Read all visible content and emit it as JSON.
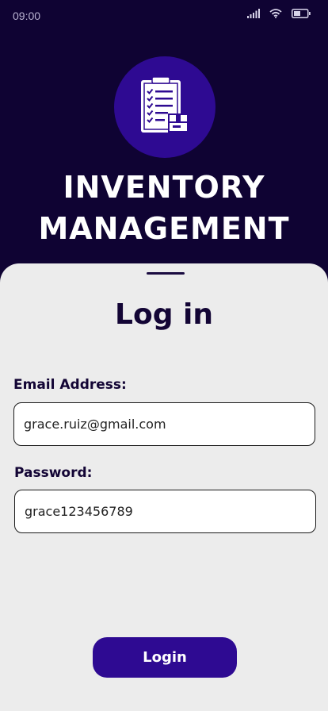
{
  "status_bar": {
    "time": "09:00",
    "icons": [
      "signal-icon",
      "wifi-icon",
      "battery-icon"
    ]
  },
  "app": {
    "logo_icon": "clipboard-checklist-box-icon",
    "title_line1": "INVENTORY",
    "title_line2": "MANAGEMENT"
  },
  "login": {
    "title": "Log in",
    "email_label": "Email Address:",
    "email_value": "grace.ruiz@gmail.com",
    "password_label": "Password:",
    "password_value": "grace123456789",
    "button_label": "Login"
  },
  "colors": {
    "background": "#0f0333",
    "accent": "#2e0a92",
    "sheet": "#ececec",
    "text_dark": "#130535"
  }
}
